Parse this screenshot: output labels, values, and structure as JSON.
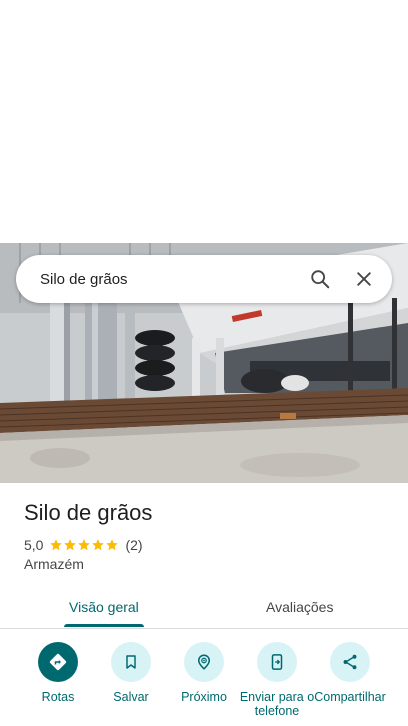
{
  "search": {
    "query": "Silo de grãos"
  },
  "place": {
    "name": "Silo de grãos",
    "rating": "5,0",
    "stars": 5,
    "review_count": "(2)",
    "category": "Armazém"
  },
  "tabs": [
    {
      "label": "Visão geral",
      "active": true
    },
    {
      "label": "Avaliações",
      "active": false
    }
  ],
  "actions": [
    {
      "label": "Rotas",
      "icon": "directions-icon"
    },
    {
      "label": "Salvar",
      "icon": "bookmark-icon"
    },
    {
      "label": "Próximo",
      "icon": "nearby-icon"
    },
    {
      "label": "Enviar para o telefone",
      "icon": "send-to-phone-icon"
    },
    {
      "label": "Compartilhar",
      "icon": "share-icon"
    }
  ],
  "colors": {
    "accent": "#00696f",
    "action_bg": "#d7f3f6",
    "star": "#fbbc04",
    "text_secondary": "#444746"
  }
}
